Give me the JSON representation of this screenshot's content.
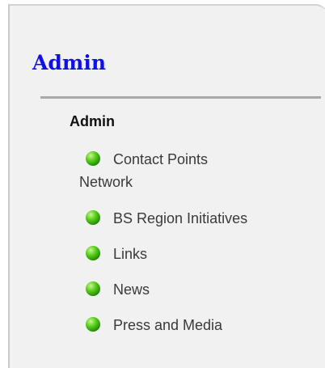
{
  "panel": {
    "title": "Admin",
    "section_heading": "Admin"
  },
  "nav": {
    "items": [
      {
        "label_line1": "Contact Points",
        "label_line2": "Network",
        "icon": "green-bullet-icon"
      },
      {
        "label": "BS Region Initiatives",
        "icon": "green-bullet-icon"
      },
      {
        "label": "Links",
        "icon": "green-bullet-icon"
      },
      {
        "label": "News",
        "icon": "green-bullet-icon"
      },
      {
        "label": "Press and Media",
        "icon": "green-bullet-icon"
      }
    ]
  },
  "colors": {
    "title": "#1010e6",
    "bullet": "#2fa80c",
    "panel_bg": "#f1f1f1",
    "divider": "#a8a8a8"
  }
}
